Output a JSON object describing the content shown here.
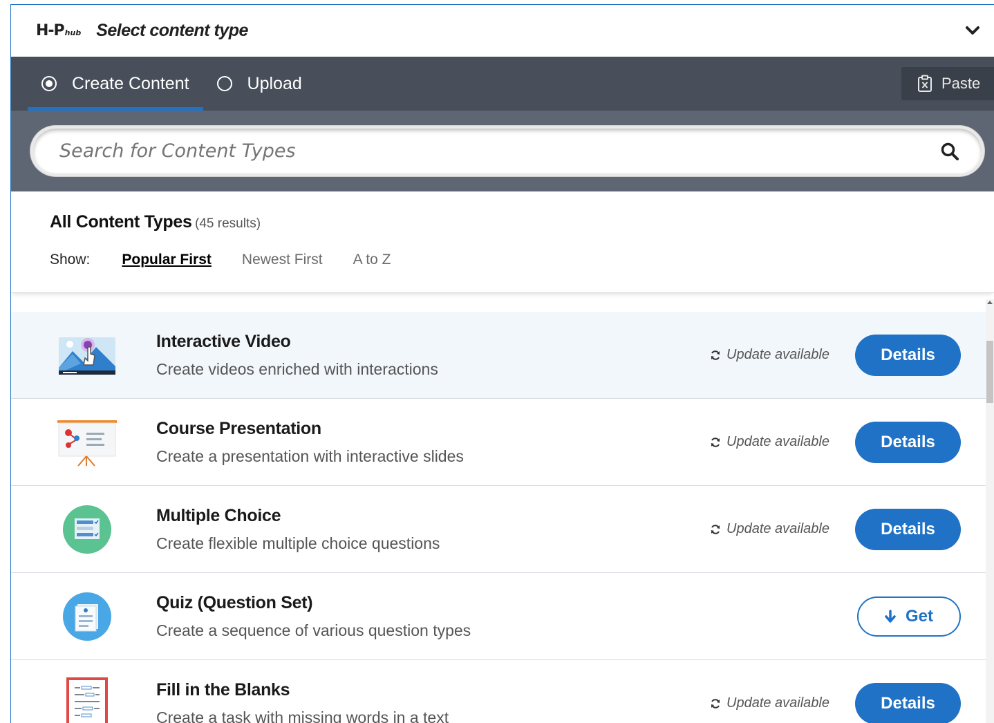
{
  "header": {
    "logo_text": "H-P",
    "logo_sub": "hub",
    "title": "Select content type"
  },
  "tabs": [
    {
      "label": "Create Content",
      "selected": true
    },
    {
      "label": "Upload",
      "selected": false
    }
  ],
  "paste_label": "Paste",
  "search": {
    "placeholder": "Search for Content Types"
  },
  "results": {
    "title": "All Content Types",
    "count": "(45 results)",
    "show_label": "Show:",
    "sort_options": [
      {
        "label": "Popular First",
        "selected": true
      },
      {
        "label": "Newest First",
        "selected": false
      },
      {
        "label": "A to Z",
        "selected": false
      }
    ]
  },
  "items": [
    {
      "title": "Interactive Video",
      "description": "Create videos enriched with interactions",
      "status": "Update available",
      "action": "Details",
      "icon": "interactive-video-icon"
    },
    {
      "title": "Course Presentation",
      "description": "Create a presentation with interactive slides",
      "status": "Update available",
      "action": "Details",
      "icon": "course-presentation-icon"
    },
    {
      "title": "Multiple Choice",
      "description": "Create flexible multiple choice questions",
      "status": "Update available",
      "action": "Details",
      "icon": "multiple-choice-icon"
    },
    {
      "title": "Quiz (Question Set)",
      "description": "Create a sequence of various question types",
      "status": "",
      "action": "Get",
      "icon": "question-set-icon"
    },
    {
      "title": "Fill in the Blanks",
      "description": "Create a task with missing words in a text",
      "status": "Update available",
      "action": "Details",
      "icon": "fill-in-blanks-icon"
    }
  ],
  "colors": {
    "primary": "#1f72c5",
    "tabbar": "#484f5a",
    "search_band": "#5d6672"
  }
}
